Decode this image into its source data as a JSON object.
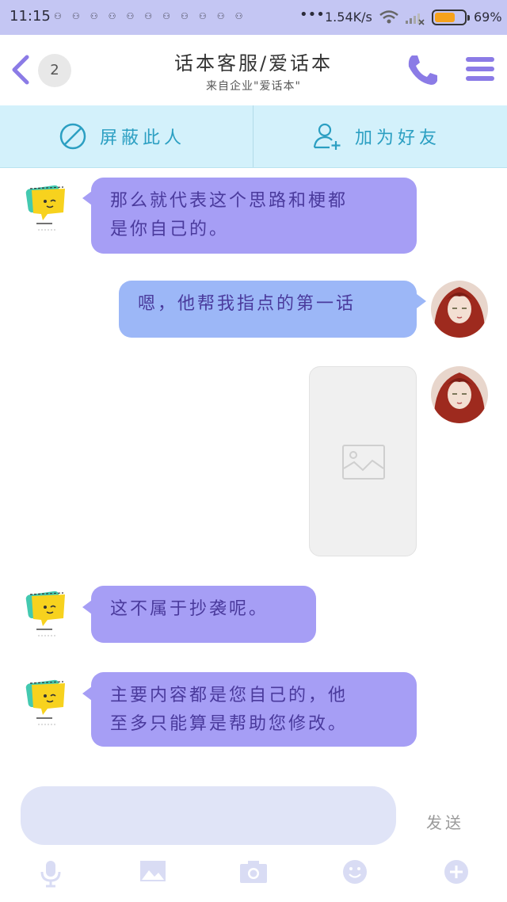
{
  "status_bar": {
    "time": "11:15",
    "notification_icons": [
      "notif-icon",
      "notif-icon",
      "notif-icon",
      "notif-icon",
      "notif-icon",
      "notif-icon",
      "notif-icon",
      "notif-icon",
      "notif-icon",
      "notif-icon",
      "notif-icon"
    ],
    "more": "•••",
    "net_speed": "1.54K/s",
    "battery_percent": "69%",
    "battery_level": 0.69,
    "battery_color": "#f6a21b"
  },
  "header": {
    "back_icon": "chevron-left-icon",
    "unread_count": "2",
    "title": "话本客服/爱话本",
    "subtitle": "来自企业\"爱话本\"",
    "call_icon": "phone-icon",
    "menu_icon": "menu-icon"
  },
  "actions": {
    "block_label": "屏蔽此人",
    "block_icon": "block-icon",
    "add_friend_label": "加为好友",
    "add_friend_icon": "add-user-icon"
  },
  "messages": [
    {
      "side": "left",
      "lines": [
        "那么就代表这个思路和梗都",
        "是你自己的。"
      ]
    },
    {
      "side": "right",
      "lines": [
        "嗯，他帮我指点的第一话"
      ]
    },
    {
      "side": "right",
      "type": "image",
      "icon": "image-placeholder-icon"
    },
    {
      "side": "left",
      "lines": [
        "这不属于抄袭呢。"
      ]
    },
    {
      "side": "left",
      "lines": [
        "主要内容都是您自己的，他",
        "至多只能算是帮助您修改。"
      ]
    }
  ],
  "composer": {
    "input_value": "",
    "send_label": "发送"
  },
  "toolbar": [
    "microphone-icon",
    "image-icon",
    "camera-icon",
    "emoji-icon",
    "plus-icon"
  ],
  "colors": {
    "accent": "#8b7be6",
    "status_bar_bg": "#c4c6f3",
    "action_bar_bg": "#d3f1fb",
    "bubble_received": "#a69ef5",
    "bubble_sent": "#9cb7f7",
    "input_bg": "#e0e4f7"
  }
}
